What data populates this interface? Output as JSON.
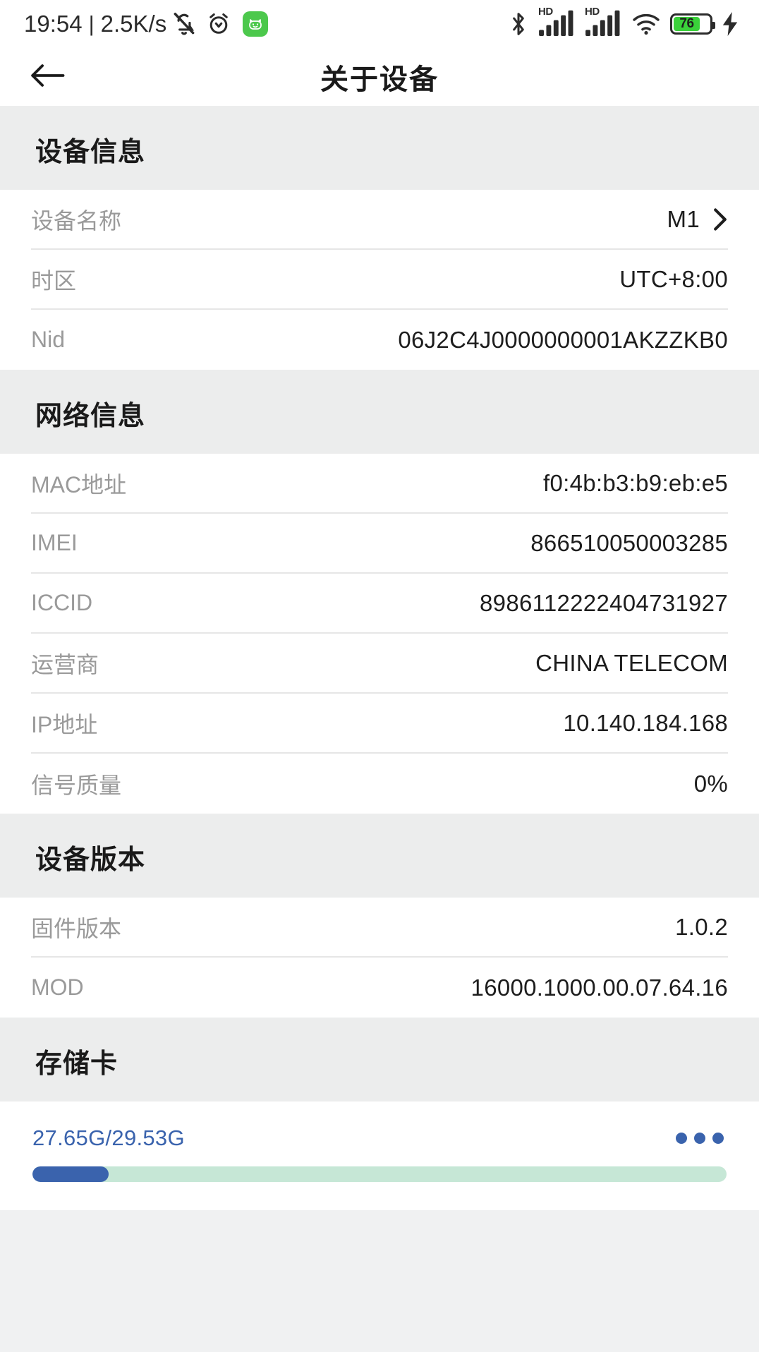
{
  "statusbar": {
    "time": "19:54",
    "separator": "|",
    "network_speed": "2.5K/s",
    "mute_icon": "mute-icon",
    "alarm_icon": "alarm-icon",
    "app_badge_icon": "app-badge-icon",
    "bluetooth_icon": "bluetooth-icon",
    "signal1_label": "HD",
    "signal2_label": "HD",
    "wifi_icon": "wifi-icon",
    "battery_level": "76",
    "battery_color": "#3ad13a",
    "charging_icon": "charging-bolt-icon"
  },
  "header": {
    "back_icon": "back-arrow-icon",
    "title": "关于设备"
  },
  "sections": [
    {
      "title": "设备信息",
      "rows": [
        {
          "label": "设备名称",
          "value": "M1",
          "chevron": true
        },
        {
          "label": "时区",
          "value": "UTC+8:00",
          "chevron": false
        },
        {
          "label": "Nid",
          "value": "06J2C4J0000000001AKZZKB0",
          "chevron": false
        }
      ]
    },
    {
      "title": "网络信息",
      "rows": [
        {
          "label": "MAC地址",
          "value": "f0:4b:b3:b9:eb:e5",
          "chevron": false
        },
        {
          "label": "IMEI",
          "value": "866510050003285",
          "chevron": false
        },
        {
          "label": "ICCID",
          "value": "8986112222404731927",
          "chevron": false
        },
        {
          "label": "运营商",
          "value": "CHINA TELECOM",
          "chevron": false
        },
        {
          "label": "IP地址",
          "value": "10.140.184.168",
          "chevron": false
        },
        {
          "label": "信号质量",
          "value": "0%",
          "chevron": false
        }
      ]
    },
    {
      "title": "设备版本",
      "rows": [
        {
          "label": "固件版本",
          "value": "1.0.2",
          "chevron": false
        },
        {
          "label": "MOD",
          "value": "16000.1000.00.07.64.16",
          "chevron": false
        }
      ]
    }
  ],
  "storage": {
    "title": "存储卡",
    "usage_text": "27.65G/29.53G",
    "free": "27.65G",
    "total": "29.53G",
    "progress_percent": 11,
    "bar_fill_color": "#3a63ad",
    "bar_track_color": "#c6e7d6",
    "text_color": "#3a63ad",
    "more_icon": "more-options-icon"
  }
}
